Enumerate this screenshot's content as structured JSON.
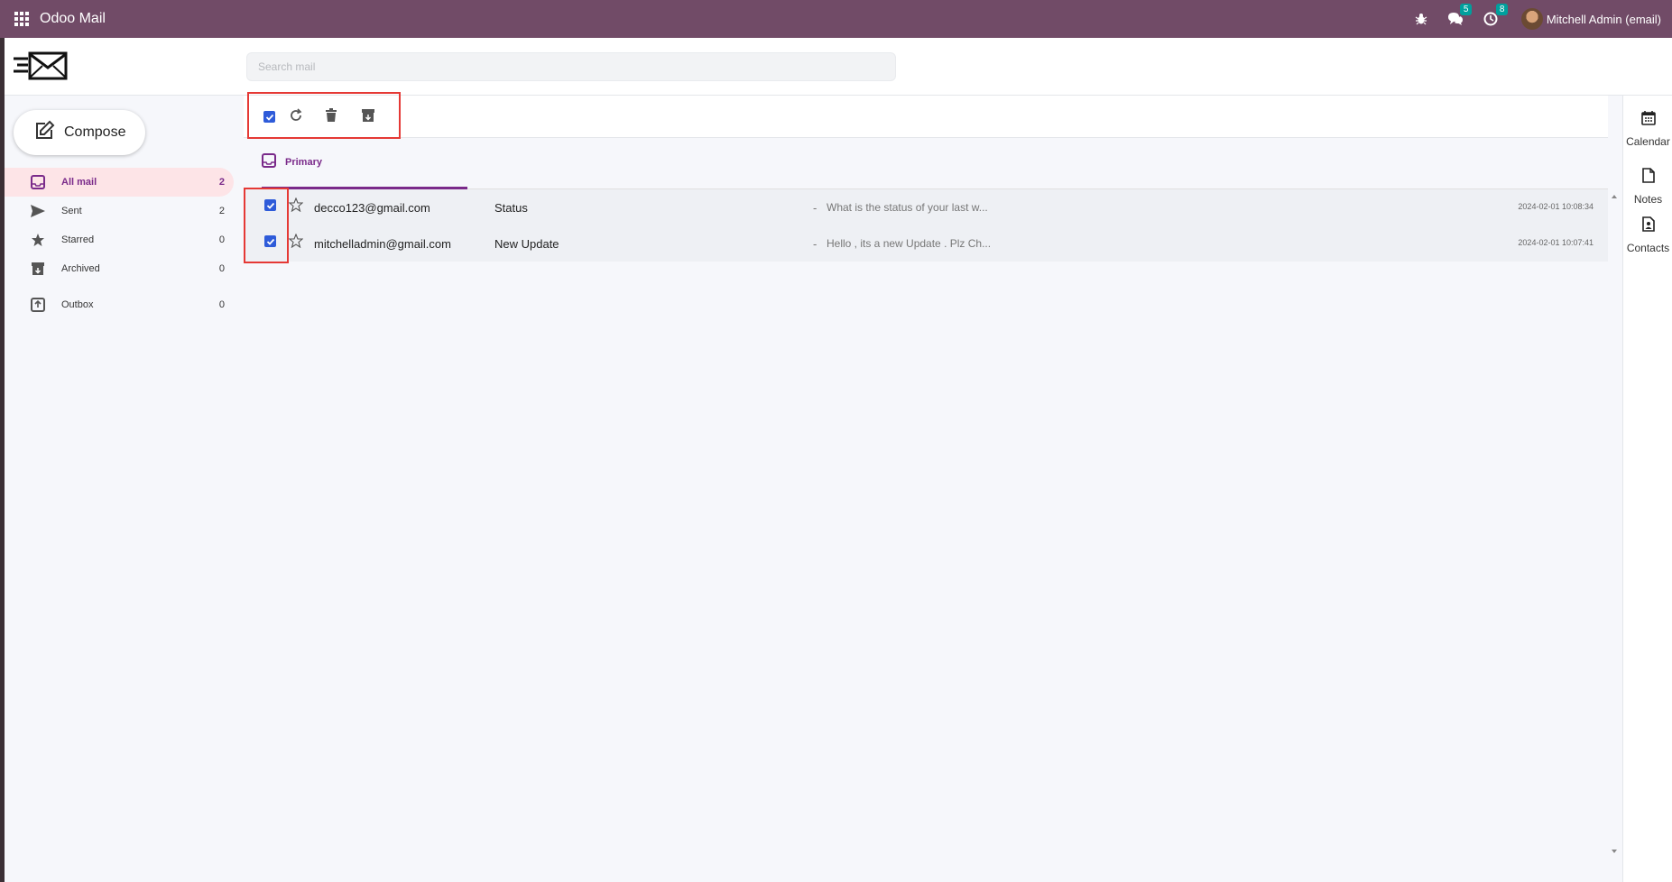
{
  "app": {
    "title": "Odoo Mail"
  },
  "navbar": {
    "chat_count": "5",
    "activity_count": "8",
    "user_name": "Mitchell Admin (email)"
  },
  "search": {
    "placeholder": "Search mail"
  },
  "compose": {
    "label": "Compose"
  },
  "sidebar": {
    "items": [
      {
        "label": "All mail",
        "count": "2"
      },
      {
        "label": "Sent",
        "count": "2"
      },
      {
        "label": "Starred",
        "count": "0"
      },
      {
        "label": "Archived",
        "count": "0"
      },
      {
        "label": "Outbox",
        "count": "0"
      }
    ]
  },
  "tabs": {
    "primary": "Primary"
  },
  "emails": [
    {
      "sender": "decco123@gmail.com",
      "subject": "Status",
      "separator": "-",
      "snippet": "What is the status of your last w...",
      "date": "2024-02-01 10:08:34"
    },
    {
      "sender": "mitchelladmin@gmail.com",
      "subject": "New Update",
      "separator": "-",
      "snippet": "Hello , its a new Update . Plz Ch...",
      "date": "2024-02-01 10:07:41"
    }
  ],
  "right_panel": {
    "calendar": "Calendar",
    "notes": "Notes",
    "contacts": "Contacts"
  },
  "colors": {
    "navbar": "#714b67",
    "accent": "#7a2a8a",
    "checkbox": "#2e5bd9",
    "highlight": "#e53935",
    "active_item": "#fde4e7"
  }
}
